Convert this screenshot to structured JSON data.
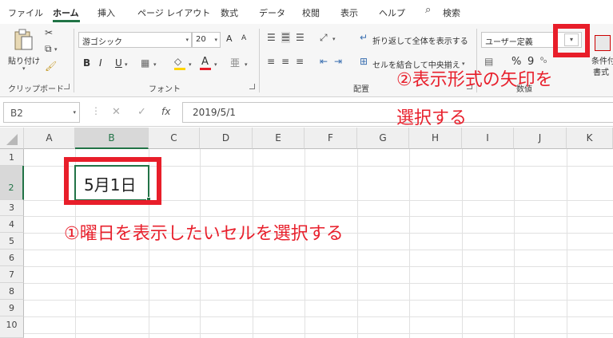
{
  "tabs": [
    {
      "label": "ファイル"
    },
    {
      "label": "ホーム"
    },
    {
      "label": "挿入"
    },
    {
      "label": "ページ レイアウト"
    },
    {
      "label": "数式"
    },
    {
      "label": "データ"
    },
    {
      "label": "校閲"
    },
    {
      "label": "表示"
    },
    {
      "label": "ヘルプ"
    }
  ],
  "search": {
    "label": "検索"
  },
  "ribbon": {
    "clipboard": {
      "paste_label": "貼り付け",
      "group_label": "クリップボード"
    },
    "font": {
      "font_name": "游ゴシック",
      "font_size": "20",
      "grow": "A",
      "shrink": "A",
      "bold": "B",
      "italic": "I",
      "underline": "U",
      "font_color_letter": "A",
      "group_label": "フォント"
    },
    "alignment": {
      "wrap_text": "折り返して全体を表示する",
      "merge_center": "セルを結合して中央揃え",
      "group_label": "配置"
    },
    "number": {
      "format": "ユーザー定義",
      "percent": "%",
      "comma": "9",
      "group_label": "数値"
    },
    "styles": {
      "conditional_line1": "条件付",
      "conditional_line2": "書式"
    }
  },
  "formula_bar": {
    "name_box": "B2",
    "cancel": "✕",
    "enter": "✓",
    "fx": "fx",
    "value": "2019/5/1"
  },
  "grid": {
    "columns": [
      "A",
      "B",
      "C",
      "D",
      "E",
      "F",
      "G",
      "H",
      "I",
      "J",
      "K"
    ],
    "rows": [
      "1",
      "2",
      "3",
      "4",
      "5",
      "6",
      "7",
      "8",
      "9",
      "10"
    ],
    "b2_value": "5月1日"
  },
  "annotations": {
    "step1": "①曜日を表示したいセルを選択する",
    "step2_line1": "②表示形式の矢印を",
    "step2_line2": "選択する",
    "highlight_color": "#e81e2a"
  },
  "colors": {
    "accent": "#217346"
  }
}
